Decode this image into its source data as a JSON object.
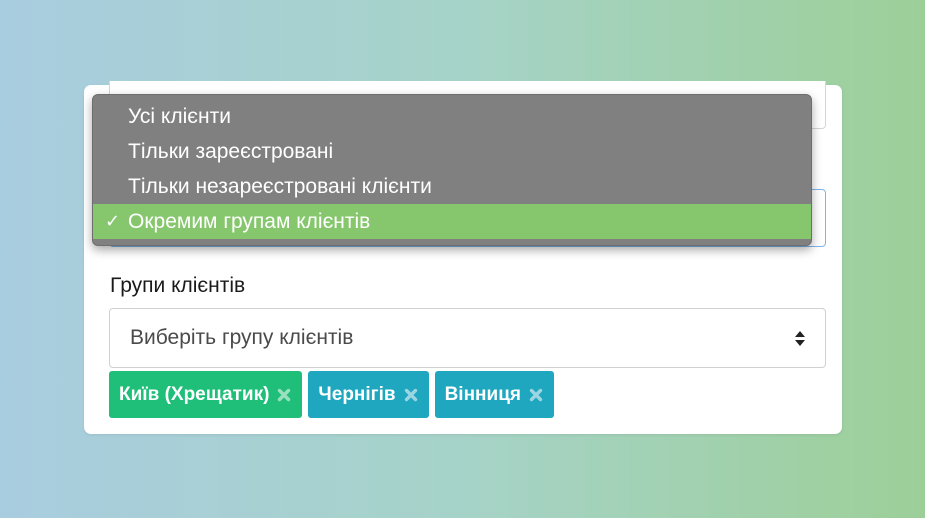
{
  "dropdown": {
    "options": [
      {
        "label": "Усі клієнти",
        "selected": false
      },
      {
        "label": "Тільки зареєстровані",
        "selected": false
      },
      {
        "label": "Тільки незареєстровані клієнти",
        "selected": false
      },
      {
        "label": "Окремим групам клієнтів",
        "selected": true
      }
    ],
    "check_glyph": "✓"
  },
  "groups": {
    "label": "Групи клієнтів",
    "select_placeholder": "Виберіть групу клієнтів",
    "tags": [
      {
        "label": "Київ (Хрещатик)",
        "color": "#1fbf7a"
      },
      {
        "label": "Чернігів",
        "color": "#1ea7bf"
      },
      {
        "label": "Вінниця",
        "color": "#1ea7bf"
      }
    ]
  },
  "colors": {
    "selected_option_bg": "#86c76d",
    "dropdown_bg": "#808080",
    "focus_border": "#7fb6ea"
  },
  "icons": {
    "select_arrows": "sort-arrows-icon",
    "tag_remove": "remove-x-icon"
  }
}
